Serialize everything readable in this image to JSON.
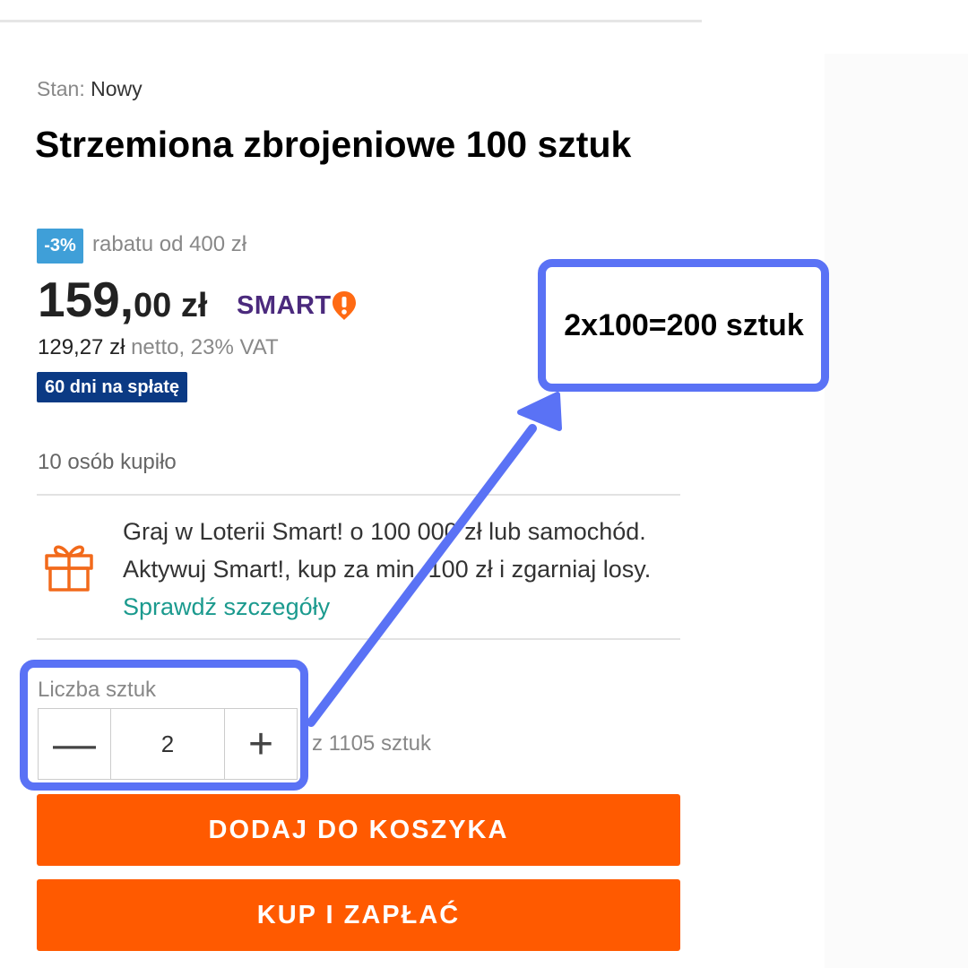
{
  "product": {
    "condition_label": "Stan:",
    "condition_value": "Nowy",
    "title": "Strzemiona zbrojeniowe 100 sztuk"
  },
  "pricing": {
    "discount_badge": "-3%",
    "discount_text": "rabatu od 400 zł",
    "price_int": "159,",
    "price_frac": "00 zł",
    "smart_label": "SMART",
    "net_price": "129,27 zł",
    "net_suffix": " netto, 23% VAT",
    "installments_badge": "60 dni na spłatę"
  },
  "social_proof": {
    "bought_text": "10 osób kupiło"
  },
  "promo": {
    "text": "Graj w Loterii Smart! o 100 000 zł lub samochód. Aktywuj Smart!, kup za min. 100 zł i zgarniaj losy. ",
    "link": "Sprawdź szczegóły"
  },
  "quantity": {
    "label": "Liczba sztuk",
    "value": "2",
    "minus_symbol": "—",
    "plus_symbol": "+",
    "available": "z 1105 sztuk"
  },
  "actions": {
    "add_to_cart": "DODAJ DO KOSZYKA",
    "buy_now": "KUP I ZAPŁAĆ"
  },
  "annotation": {
    "text": "2x100=200 sztuk",
    "color": "#5a72f5"
  },
  "colors": {
    "accent_orange": "#ff5a00",
    "badge_blue": "#3f9fd8",
    "installments_navy": "#0b3a84",
    "smart_purple": "#4b2a7d",
    "smart_orange": "#ff6a13",
    "link_teal": "#1b9a8e"
  }
}
